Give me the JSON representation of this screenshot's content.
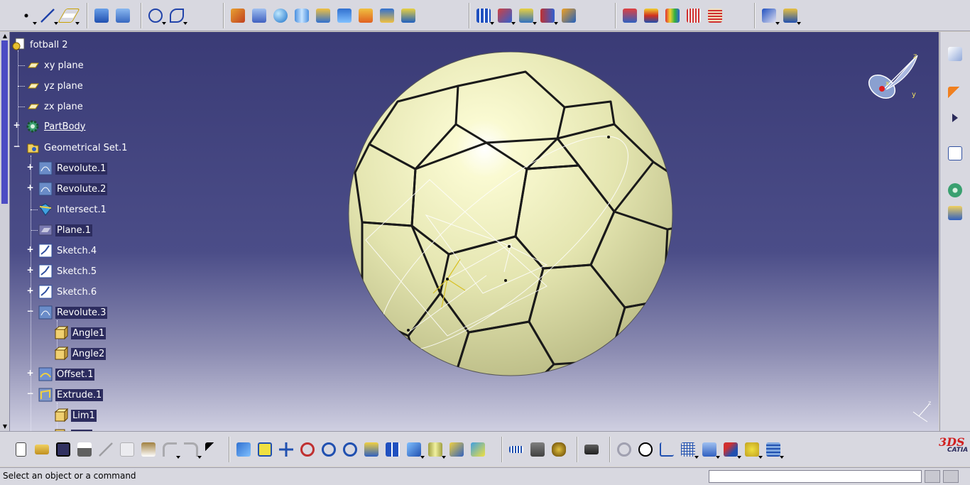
{
  "tree": {
    "root": "fotball 2",
    "items": [
      {
        "label": "xy plane",
        "icon": "plane-icon"
      },
      {
        "label": "yz plane",
        "icon": "plane-icon"
      },
      {
        "label": "zx plane",
        "icon": "plane-icon"
      },
      {
        "label": "PartBody",
        "icon": "partbody-gear-icon"
      },
      {
        "label": "Geometrical Set.1",
        "icon": "geometrical-set-icon"
      },
      {
        "label": "Revolute.1",
        "icon": "revolute-icon"
      },
      {
        "label": "Revolute.2",
        "icon": "revolute-icon"
      },
      {
        "label": "Intersect.1",
        "icon": "intersect-icon"
      },
      {
        "label": "Plane.1",
        "icon": "plane-feature-icon"
      },
      {
        "label": "Sketch.4",
        "icon": "sketch-icon"
      },
      {
        "label": "Sketch.5",
        "icon": "sketch-icon"
      },
      {
        "label": "Sketch.6",
        "icon": "sketch-icon"
      },
      {
        "label": "Revolute.3",
        "icon": "revolute-icon"
      },
      {
        "label": "Angle1",
        "icon": "parameter-box-icon"
      },
      {
        "label": "Angle2",
        "icon": "parameter-box-icon"
      },
      {
        "label": "Offset.1",
        "icon": "offset-icon"
      },
      {
        "label": "Extrude.1",
        "icon": "extrude-icon"
      },
      {
        "label": "Lim1",
        "icon": "parameter-box-icon"
      }
    ]
  },
  "status": {
    "message": "Select an object or a command",
    "command_input": ""
  },
  "brand": {
    "logo_text": "CATIA",
    "logo_mark": "3DS"
  },
  "compass": {
    "x_label": "x",
    "y_label": "y",
    "z_label": "z"
  },
  "colors": {
    "viewport_top": "#3a3b76",
    "viewport_bottom": "#cfcfe1",
    "ball": "#e8e9b8",
    "selection": "#2c2c5e"
  }
}
